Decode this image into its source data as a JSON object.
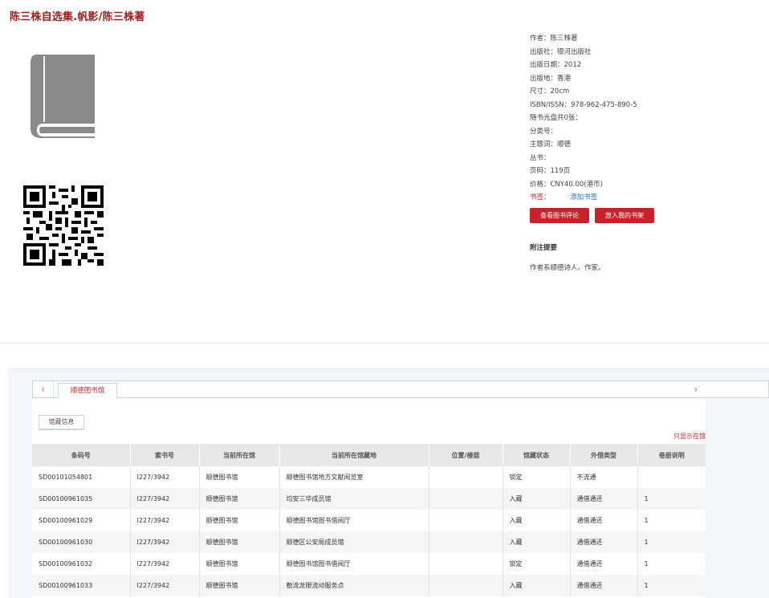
{
  "book": {
    "title": "陈三株自选集.帆影/陈三株著"
  },
  "meta": {
    "author": "作者：陈三株著",
    "publisher": "出版社：银河出版社",
    "pub_date": "出版日期：2012",
    "pub_place": "出版地：香港",
    "size": "尺寸：20cm",
    "isbn": "ISBN/ISSN：978-962-475-890-5",
    "cd": "随书光盘共0张：",
    "class_no": "分类号：",
    "subject": "主题词：顺德",
    "series": "丛书：",
    "pages": "页码：119页",
    "price": "价格：CNY40.00(港币)",
    "tags_label": "书签：",
    "add_tag": "添加书签"
  },
  "buttons": {
    "view_reviews": "查看图书评论",
    "add_shelf": "放入我的书架"
  },
  "notes": {
    "title": "附注提要",
    "text": "作者系顺德诗人、作家。"
  },
  "library_tabs": {
    "prev_icon": "chevron-left-icon",
    "next_icon": "chevron-right-icon",
    "active": "顺德图书馆"
  },
  "holdings": {
    "subtab": "馆藏信息",
    "only_show": "只显示在馆",
    "columns": [
      "条码号",
      "索书号",
      "当前所在馆",
      "当前所在馆藏地",
      "位置/楼层",
      "馆藏状态",
      "外借类型",
      "卷册说明"
    ],
    "rows": [
      [
        "SD00101054801",
        "I227/3942",
        "顺德图书馆",
        "顺德图书馆地方文献阅览室",
        "",
        "锁定",
        "不流通",
        ""
      ],
      [
        "SD00100961035",
        "I227/3942",
        "顺德图书馆",
        "均安三华成员馆",
        "",
        "入藏",
        "通借通还",
        "1"
      ],
      [
        "SD00100961029",
        "I227/3942",
        "顺德图书馆",
        "顺德图书馆图书借阅厅",
        "",
        "入藏",
        "通借通还",
        "1"
      ],
      [
        "SD00100961030",
        "I227/3942",
        "顺德图书馆",
        "顺德区公安局成员馆",
        "",
        "入藏",
        "通借通还",
        "1"
      ],
      [
        "SD00100961032",
        "I227/3942",
        "顺德图书馆",
        "顺德图书馆图书借阅厅",
        "",
        "锁定",
        "通借通还",
        "1"
      ],
      [
        "SD00100961033",
        "I227/3942",
        "顺德图书馆",
        "勒流龙眼流动服务点",
        "",
        "入藏",
        "通借通还",
        "1"
      ]
    ]
  }
}
